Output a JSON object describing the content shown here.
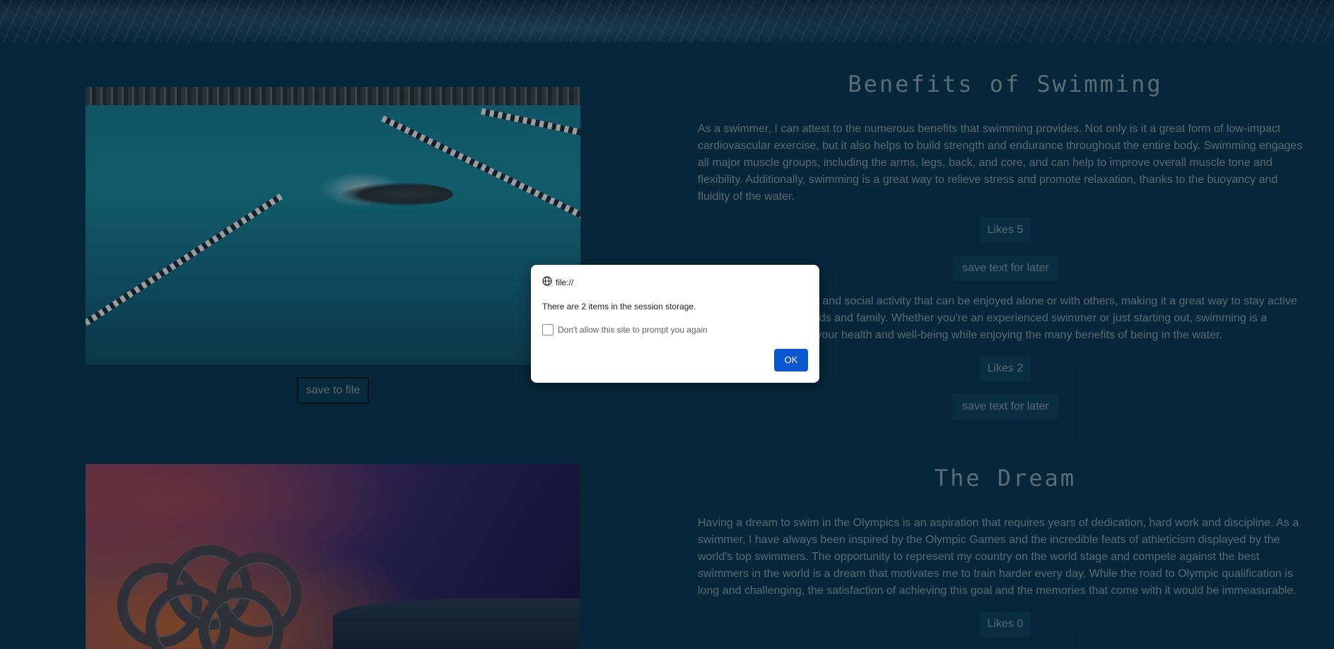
{
  "section1": {
    "title": "Benefits of Swimming",
    "para1": "As a swimmer, I can attest to the numerous benefits that swimming provides. Not only is it a great form of low-impact cardiovascular exercise, but it also helps to build strength and endurance throughout the entire body. Swimming engages all major muscle groups, including the arms, legs, back, and core, and can help to improve overall muscle tone and flexibility. Additionally, swimming is a great way to relieve stress and promote relaxation, thanks to the buoyancy and fluidity of the water.",
    "likes1": "Likes 5",
    "save_text1": "save text for later",
    "para2_line1": "n and social activity that can be enjoyed alone or with others, making it a great way to stay active",
    "para2_line2": "nds and family. Whether you're an experienced swimmer or just starting out, swimming is a",
    "para2_line3": " your health and well-being while enjoying the many benefits of being in the water.",
    "likes2": "Likes 2",
    "save_text2": "save text for later",
    "save_file": "save to file"
  },
  "section2": {
    "title": "The Dream",
    "para": "Having a dream to swim in the Olympics is an aspiration that requires years of dedication, hard work and discipline. As a swimmer, I have always been inspired by the Olympic Games and the incredible feats of athleticism displayed by the world's top swimmers. The opportunity to represent my country on the world stage and compete against the best swimmers in the world is a dream that motivates me to train harder every day. While the road to Olympic qualification is long and challenging, the satisfaction of achieving this goal and the memories that come with it would be immeasurable.",
    "likes": "Likes 0"
  },
  "dialog": {
    "origin": "file://",
    "message": "There are 2 items in the session storage.",
    "checkbox_label": "Don't allow this site to prompt you again",
    "ok": "OK"
  },
  "icons": {
    "origin": "globe-icon"
  }
}
